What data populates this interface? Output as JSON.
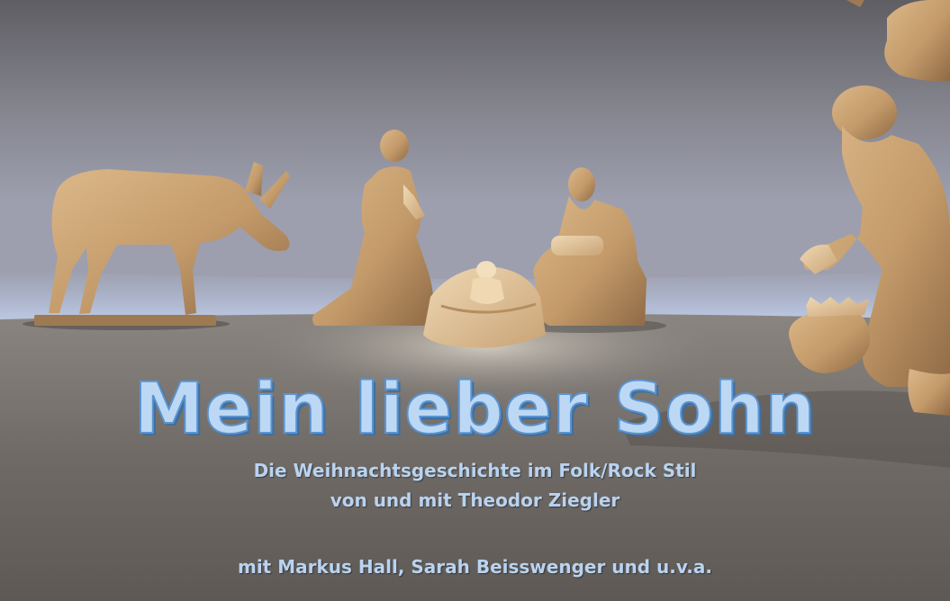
{
  "title": "Mein lieber Sohn",
  "subtitle_line1": "Die Weihnachtsgeschichte im Folk/Rock Stil",
  "subtitle_line2": "von und mit Theodor Ziegler",
  "cast_line": "mit Markus Hall, Sarah Beisswenger und u.v.a.",
  "colors": {
    "title_fill": "#bcd8f4",
    "title_outline": "#5a93cf",
    "wood": "#c9a172",
    "backdrop": "#8b8a92",
    "floor": "#7e7770"
  }
}
